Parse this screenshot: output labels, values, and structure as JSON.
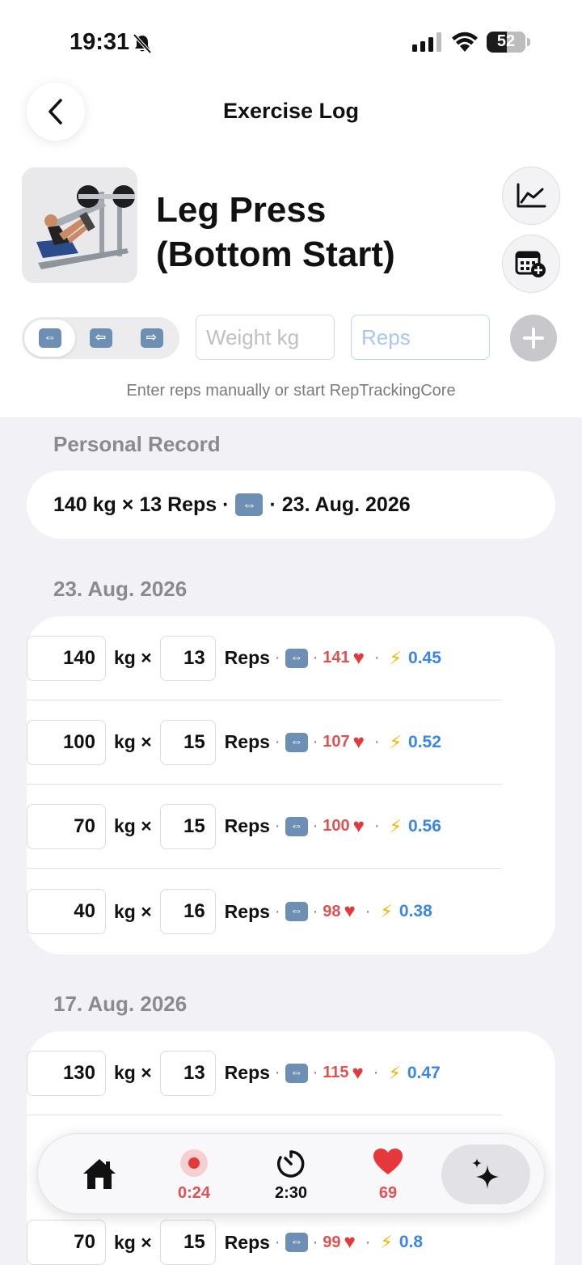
{
  "status_bar": {
    "time": "19:31",
    "battery": "52"
  },
  "nav": {
    "title": "Exercise Log"
  },
  "exercise": {
    "title_line1": "Leg Press",
    "title_line2": "(Bottom Start)"
  },
  "entry": {
    "weight_placeholder": "Weight kg",
    "reps_placeholder": "Reps",
    "hint": "Enter reps manually or start RepTrackingCore"
  },
  "personal_record": {
    "label": "Personal Record",
    "part1": "140 kg × 13 Reps ·",
    "part2": "· 23. Aug. 2026"
  },
  "units": {
    "kg": "kg ×",
    "reps": "Reps"
  },
  "sessions": [
    {
      "date": "23. Aug. 2026",
      "sets": [
        {
          "weight": "140",
          "reps": "13",
          "hr": "141",
          "velocity": "0.45"
        },
        {
          "weight": "100",
          "reps": "15",
          "hr": "107",
          "velocity": "0.52"
        },
        {
          "weight": "70",
          "reps": "15",
          "hr": "100",
          "velocity": "0.56"
        },
        {
          "weight": "40",
          "reps": "16",
          "hr": "98",
          "velocity": "0.38"
        }
      ]
    },
    {
      "date": "17. Aug. 2026",
      "sets": [
        {
          "weight": "130",
          "reps": "13",
          "hr": "115",
          "velocity": "0.47"
        },
        {
          "weight": "70",
          "reps": "15",
          "hr": "99",
          "velocity": "0.8"
        }
      ]
    }
  ],
  "tab_bar": {
    "recording": "0:24",
    "timer": "2:30",
    "heart_rate": "69"
  },
  "colors": {
    "accent_blue": "#3a86e8",
    "hr_red": "#e05252",
    "bolt_yellow": "#f5b400",
    "background": "#f1f1f6"
  }
}
